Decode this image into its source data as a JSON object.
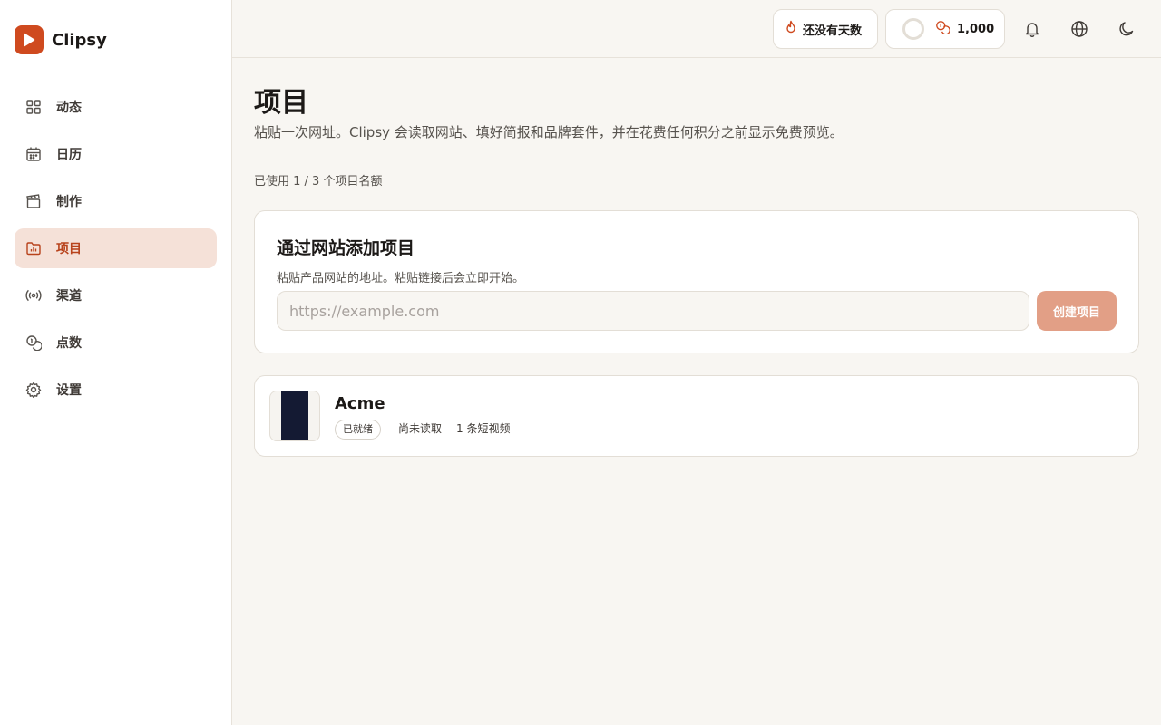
{
  "app": {
    "name": "Clipsy"
  },
  "sidebar": {
    "items": [
      {
        "label": "动态",
        "icon": "grid-icon"
      },
      {
        "label": "日历",
        "icon": "calendar-icon"
      },
      {
        "label": "制作",
        "icon": "clapperboard-icon"
      },
      {
        "label": "项目",
        "icon": "folder-chart-icon",
        "active": true
      },
      {
        "label": "渠道",
        "icon": "broadcast-icon"
      },
      {
        "label": "点数",
        "icon": "coins-icon"
      },
      {
        "label": "设置",
        "icon": "gear-icon"
      }
    ]
  },
  "topbar": {
    "streak_label": "还没有天数",
    "credits_value": "1,000",
    "icons": [
      "bell-icon",
      "globe-icon",
      "moon-icon"
    ]
  },
  "page": {
    "title": "项目",
    "description": "粘贴一次网址。Clipsy 会读取网站、填好简报和品牌套件，并在花费任何积分之前显示免费预览。",
    "quota": "已使用 1 / 3 个项目名额"
  },
  "add_project": {
    "title": "通过网站添加项目",
    "subtitle": "粘贴产品网站的地址。粘贴链接后会立即开始。",
    "input_placeholder": "https://example.com",
    "input_value": "",
    "button_label": "创建项目"
  },
  "projects": [
    {
      "name": "Acme",
      "status": "已就绪",
      "read_status": "尚未读取",
      "videos": "1 条短视频"
    }
  ],
  "colors": {
    "accent": "#cf4a1f",
    "active_bg": "#f5e1d8",
    "active_text": "#b8431c",
    "button_disabled": "#e29f86",
    "background": "#f8f6f2"
  }
}
